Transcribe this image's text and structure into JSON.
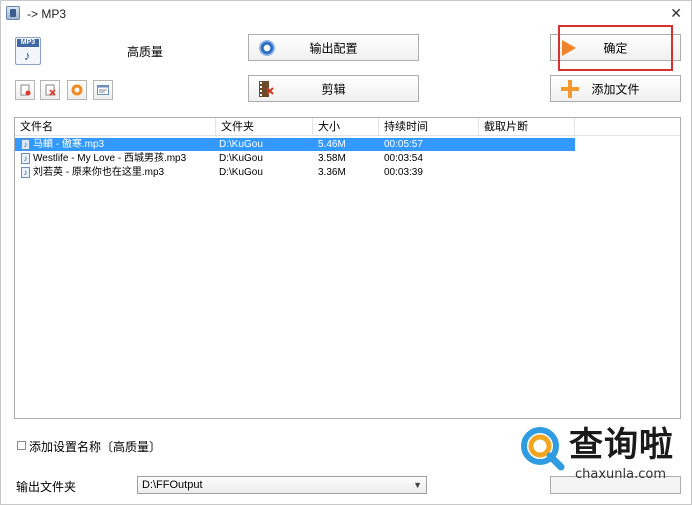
{
  "window": {
    "title": "-> MP3"
  },
  "header": {
    "format_icon_text": "MP3",
    "quality_label": "高质量"
  },
  "buttons": {
    "output_config": "输出配置",
    "clip": "剪辑",
    "ok": "确定",
    "add_file": "添加文件"
  },
  "file_list": {
    "columns": [
      "文件名",
      "文件夹",
      "大小",
      "持续时间",
      "截取片断"
    ],
    "rows": [
      {
        "name": "马頔 - 傲寒.mp3",
        "folder": "D:\\KuGou",
        "size": "5.46M",
        "duration": "00:05:57",
        "clip": "",
        "selected": true
      },
      {
        "name": "Westlife - My Love - 西城男孩.mp3",
        "folder": "D:\\KuGou",
        "size": "3.58M",
        "duration": "00:03:54",
        "clip": "",
        "selected": false
      },
      {
        "name": "刘若英 - 原来你也在这里.mp3",
        "folder": "D:\\KuGou",
        "size": "3.36M",
        "duration": "00:03:39",
        "clip": "",
        "selected": false
      }
    ]
  },
  "options": {
    "add_setting_name_label": "添加设置名称〔高质量〕",
    "add_setting_name_checked": false
  },
  "output": {
    "folder_label": "输出文件夹",
    "folder_value": "D:\\FFOutput"
  },
  "watermark": {
    "title": "查询啦",
    "url": "chaxunla.com"
  },
  "colors": {
    "selection": "#3399ff",
    "highlight_box": "#d93030",
    "ok_icon": "#f0832a",
    "add_icon": "#f29a2e"
  }
}
